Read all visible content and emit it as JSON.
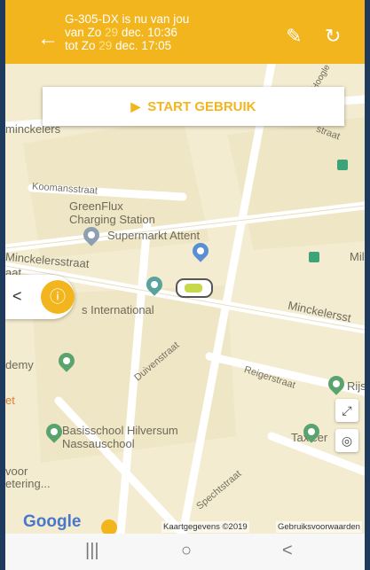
{
  "header": {
    "line1": "G-305-DX is nu van jou",
    "from_prefix": "van Zo ",
    "from_day": "29",
    "from_rest": " dec. 10:36",
    "to_prefix": "tot Zo ",
    "to_day": "29",
    "to_rest": " dec. 17:05",
    "back_icon": "arrow-left-icon",
    "edit_icon": "pencil-icon",
    "refresh_icon": "refresh-icon",
    "bg_color": "#f2b51d"
  },
  "start_button": {
    "label": "START GEBRUIK"
  },
  "map": {
    "labels": {
      "minckelers_top": "minckelers",
      "koomansstraat": "Koomansstraat",
      "greenflux1": "GreenFlux",
      "greenflux2": "Charging Station",
      "supermarkt": "Supermarkt Attent",
      "minckelersstraat1": "Minckelersstraat",
      "aat": "aat",
      "minckelers_right": "Minckelersst",
      "international": "s International",
      "duivenstraat": "Duivenstraat",
      "demy": "demy",
      "reigerstraat": "Reigerstraat",
      "et": "et",
      "rijs": "Rijs",
      "basisschool1": "Basisschool Hilversum",
      "basisschool2": "Nassauschool",
      "taxicer": "Taxicer",
      "voor": "voor",
      "etering": "etering...",
      "spechtstraat": "Spechtstraat",
      "mil": "Mil",
      "straat_top": "straat",
      "hoogle": "Hoogle"
    },
    "google": "Google",
    "attribution": "Kaartgegevens ©2019",
    "terms": "Gebruiksvoorwaarden"
  },
  "navbar": {
    "recent": "|||",
    "home": "○",
    "back": "<"
  }
}
